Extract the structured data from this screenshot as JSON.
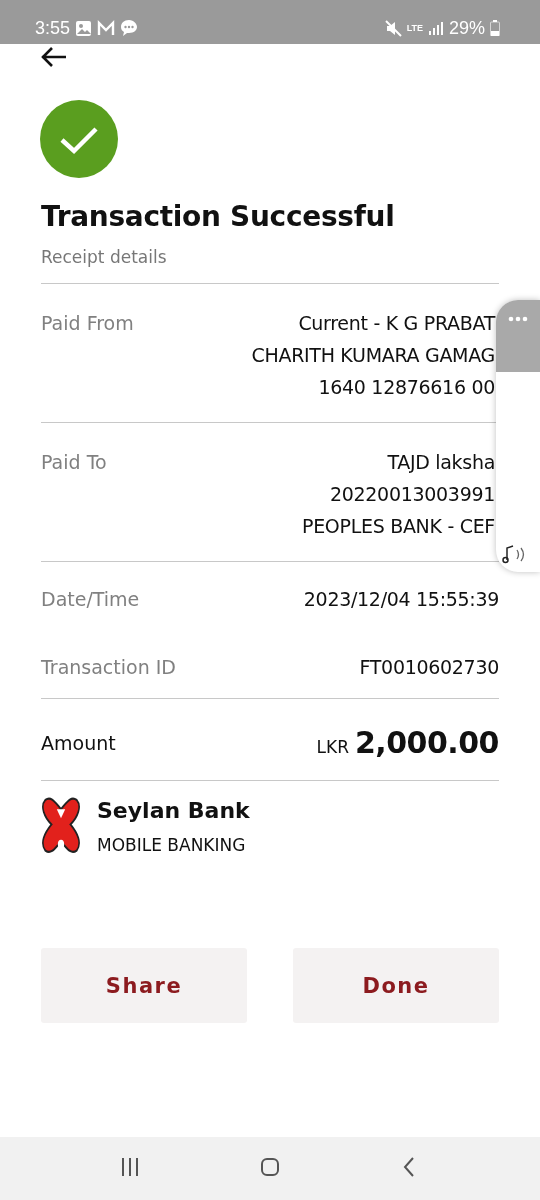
{
  "status_bar": {
    "time": "3:55",
    "network": "LTE",
    "battery": "29%"
  },
  "header": {
    "title": "Transaction Successful",
    "subtitle": "Receipt details"
  },
  "details": [
    {
      "label": "Paid From",
      "values": [
        "Current - K G PRABAT",
        "CHARITH KUMARA GAMAG",
        "1640 12876616 00"
      ]
    },
    {
      "label": "Paid To",
      "values": [
        "TAJD laksha",
        "20220013003991",
        "PEOPLES BANK - CEF"
      ]
    },
    {
      "label": "Date/Time",
      "values": [
        "2023/12/04 15:55:39"
      ]
    },
    {
      "label": "Transaction ID",
      "values": [
        "FT0010602730"
      ]
    }
  ],
  "amount": {
    "label": "Amount",
    "currency": "LKR",
    "value": "2,000.00"
  },
  "brand": {
    "name": "Seylan Bank",
    "tagline": "MOBILE BANKING"
  },
  "buttons": [
    {
      "label": "Share"
    },
    {
      "label": "Done"
    }
  ]
}
